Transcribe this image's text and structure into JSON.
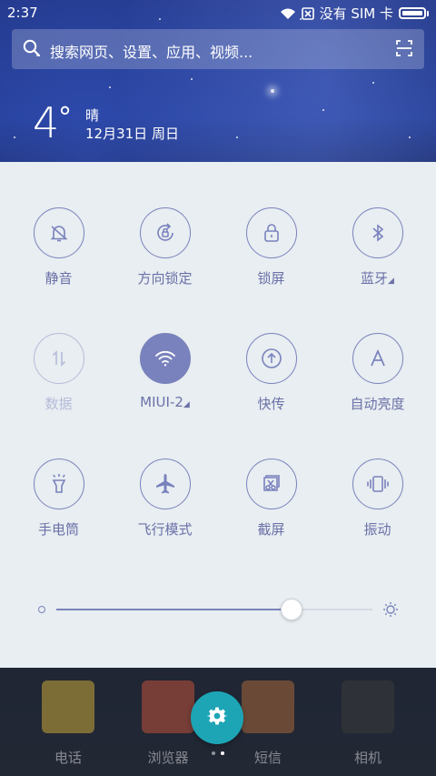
{
  "status_bar": {
    "time": "2:37",
    "sim_text": "没有 SIM 卡"
  },
  "search": {
    "placeholder": "搜索网页、设置、应用、视频..."
  },
  "weather": {
    "temperature": "4",
    "degree_symbol": "°",
    "condition": "晴",
    "date": "12月31日 周日"
  },
  "toggles": [
    {
      "label": "静音",
      "icon": "bell-off-icon",
      "state": "off"
    },
    {
      "label": "方向锁定",
      "icon": "rotation-lock-icon",
      "state": "off"
    },
    {
      "label": "锁屏",
      "icon": "lock-icon",
      "state": "off"
    },
    {
      "label": "蓝牙",
      "icon": "bluetooth-icon",
      "state": "off",
      "has_submenu": true
    },
    {
      "label": "数据",
      "icon": "mobile-data-icon",
      "state": "disabled"
    },
    {
      "label": "MIUI-2",
      "icon": "wifi-icon",
      "state": "on",
      "has_submenu": true
    },
    {
      "label": "快传",
      "icon": "upload-icon",
      "state": "off"
    },
    {
      "label": "自动亮度",
      "icon": "auto-brightness-icon",
      "state": "off"
    },
    {
      "label": "手电筒",
      "icon": "flashlight-icon",
      "state": "off"
    },
    {
      "label": "飞行模式",
      "icon": "airplane-icon",
      "state": "off"
    },
    {
      "label": "截屏",
      "icon": "screenshot-icon",
      "state": "off"
    },
    {
      "label": "振动",
      "icon": "vibrate-icon",
      "state": "off"
    }
  ],
  "brightness": {
    "level": 0.74
  },
  "dock": [
    {
      "label": "电话",
      "icon": "phone-app-icon"
    },
    {
      "label": "浏览器",
      "icon": "browser-app-icon"
    },
    {
      "label": "短信",
      "icon": "messages-app-icon"
    },
    {
      "label": "相机",
      "icon": "camera-app-icon"
    }
  ],
  "colors": {
    "accent": "#7a82bd",
    "fab": "#1da5b6",
    "panel": "#e8eef1"
  }
}
